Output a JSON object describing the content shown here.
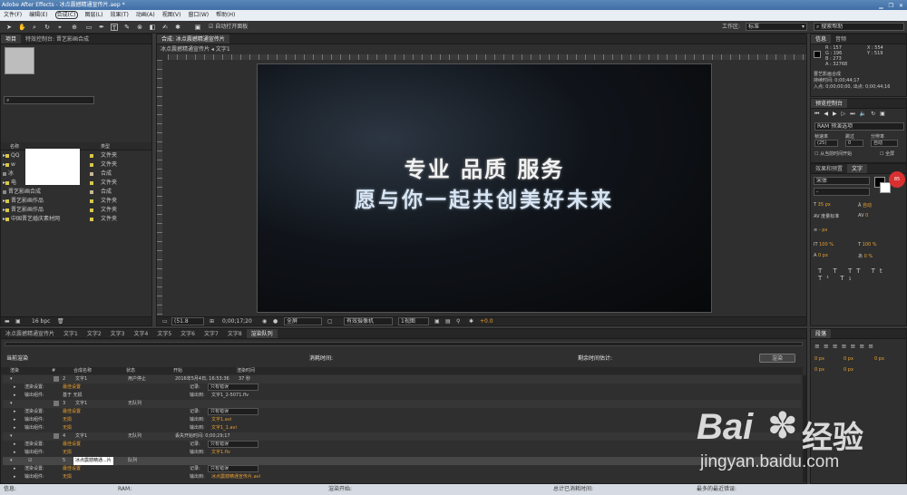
{
  "window": {
    "title": "Adobe After Effects - 冰点震撼精通宣传片.aep *"
  },
  "menu": [
    "文件(F)",
    "编辑(E)",
    "合成(C)",
    "图层(L)",
    "效果(T)",
    "动画(A)",
    "视图(V)",
    "窗口(W)",
    "帮助(H)"
  ],
  "toolbar": {
    "auto_open": "自动打开面板",
    "workspace_label": "工作区:",
    "workspace_value": "标准",
    "search_placeholder": "搜索帮助"
  },
  "project": {
    "tabs": [
      "项目",
      "特效控制台: 晋艺影画合成"
    ],
    "col_name": "名称",
    "col_type": "类型",
    "items": [
      {
        "name": "QQ",
        "type": "文件夹",
        "color": "#d8c84a"
      },
      {
        "name": "w",
        "type": "文件夹",
        "color": "#d8c84a"
      },
      {
        "name": "冰",
        "type": "合成",
        "color": "#c8b89a"
      },
      {
        "name": "电",
        "type": "文件夹",
        "color": "#d8c84a"
      },
      {
        "name": "晋艺影画合成",
        "type": "合成",
        "color": "#c8b89a"
      },
      {
        "name": "晋艺影画作品",
        "type": "文件夹",
        "color": "#d8c84a"
      },
      {
        "name": "晋艺影画作品",
        "type": "文件夹",
        "color": "#d8c84a"
      },
      {
        "name": "中国晋艺婚庆素材网",
        "type": "文件夹",
        "color": "#d8c84a"
      }
    ],
    "bpc": "16 bpc"
  },
  "comp": {
    "tabs": [
      "合成: 冰点震撼精通宣传片"
    ],
    "breadcrumb": [
      "冰点震撼精通宣传片",
      "文字1"
    ],
    "line1": "专业 品质 服务",
    "line2": "愿与你一起共创美好未来",
    "footer": {
      "zoom": "(51.8",
      "time": "0;00;17;20",
      "quality": "全屏",
      "camera": "有效摄像机",
      "views": "1视图",
      "exposure": "+0.0"
    }
  },
  "info": {
    "tabs": [
      "信息",
      "音频"
    ],
    "r": "R : 157",
    "g": "G : 196",
    "b": "B : 273",
    "a": "A : 32768",
    "x": "X : 554",
    "y": "Y : 519",
    "name": "晋艺影画合成",
    "duration": "持续时间: 0;00;44;17",
    "inout": "入点: 0;00;00;00, 出点: 0;00;44;16"
  },
  "preview": {
    "title": "预览控制台",
    "ram": "RAM 预演选项",
    "fps_label": "帧速率",
    "skip_label": "跳过",
    "res_label": "分辨率",
    "fps": "(25)",
    "skip": "0",
    "res": "自动",
    "from_current": "从当前时间开始",
    "full": "全屏"
  },
  "effects": {
    "tabs": [
      "效果和预置",
      "文字"
    ],
    "font": "宋体",
    "style": "-",
    "size1": "35 px",
    "size2": "自动",
    "kern": "度量标准",
    "track": "0",
    "px": "- px",
    "scale1": "100 %",
    "scale2": "100 %",
    "baseline": "0 px",
    "tsume": "0 %"
  },
  "paragraph": {
    "title": "段落",
    "v0": "0 px",
    "v1": "0 px",
    "v2": "0 px",
    "v3": "0 px",
    "v4": "0 px"
  },
  "timeline": {
    "tabs": [
      "冰点震撼精通宣传片",
      "文字1",
      "文字2",
      "文字3",
      "文字4",
      "文字5",
      "文字6",
      "文字7",
      "文字8",
      "渲染队列"
    ],
    "current_render": "当前渲染",
    "elapsed": "消耗时间:",
    "remaining": "剩余时间估计:",
    "render_btn": "渲染",
    "headers": [
      "渲染",
      "#",
      "合成名称",
      "状态",
      "开始",
      "渲染时间"
    ],
    "rows": [
      {
        "kind": "item",
        "num": "2",
        "name": "文字1",
        "status": "用户停止",
        "start": "2016年5月4日, 16:53:36",
        "time": "37 秒"
      },
      {
        "kind": "sub",
        "label": "渲染设置:",
        "val": "最佳设置",
        "r_label": "记录:",
        "r_val": "只有错误"
      },
      {
        "kind": "sub",
        "label": "输出组件:",
        "val": "基于 无损",
        "r_label": "输出到:",
        "r_val": "文字1_2-5071.flv"
      },
      {
        "kind": "item",
        "num": "3",
        "name": "文字1",
        "status": "无队列",
        "start": "",
        "time": ""
      },
      {
        "kind": "sub",
        "label": "渲染设置:",
        "val": "最佳设置",
        "r_label": "记录:",
        "r_val": "只有错误"
      },
      {
        "kind": "sub",
        "label": "输出组件:",
        "val": "无损",
        "r_label": "输出到:",
        "r_val": "文字1.avi"
      },
      {
        "kind": "sub",
        "label": "输出组件:",
        "val": "无损",
        "r_label": "输出到:",
        "r_val": "文字1_1.avi"
      },
      {
        "kind": "item",
        "num": "4",
        "name": "文字1",
        "status": "无队列",
        "start": "丢失开始时间: 0;00;29;17",
        "time": ""
      },
      {
        "kind": "sub",
        "label": "渲染设置:",
        "val": "最佳设置",
        "r_label": "记录:",
        "r_val": "只有错误"
      },
      {
        "kind": "sub",
        "label": "输出组件:",
        "val": "无损",
        "r_label": "输出到:",
        "r_val": "文字1.flv"
      },
      {
        "kind": "item",
        "num": "5",
        "name": "冰点震撼精通...片",
        "status": "队列",
        "start": "",
        "time": ""
      },
      {
        "kind": "sub",
        "label": "渲染设置:",
        "val": "最佳设置",
        "r_label": "记录:",
        "r_val": "只有错误"
      },
      {
        "kind": "sub",
        "label": "输出组件:",
        "val": "无损",
        "r_label": "输出到:",
        "r_val": "冰点震撼精通宣传片.avi"
      }
    ],
    "status": [
      "信息:",
      "RAM:",
      "渲染开始:",
      "总计已消耗时间:",
      "最多的最近错误:"
    ]
  },
  "watermark": {
    "brand": "Bai",
    "brand2": "经验",
    "url": "jingyan.baidu.com"
  },
  "colors": {
    "accent": "#e8a033",
    "bg": "#3a3a3a",
    "comp_bg": "#0b0d0f"
  }
}
